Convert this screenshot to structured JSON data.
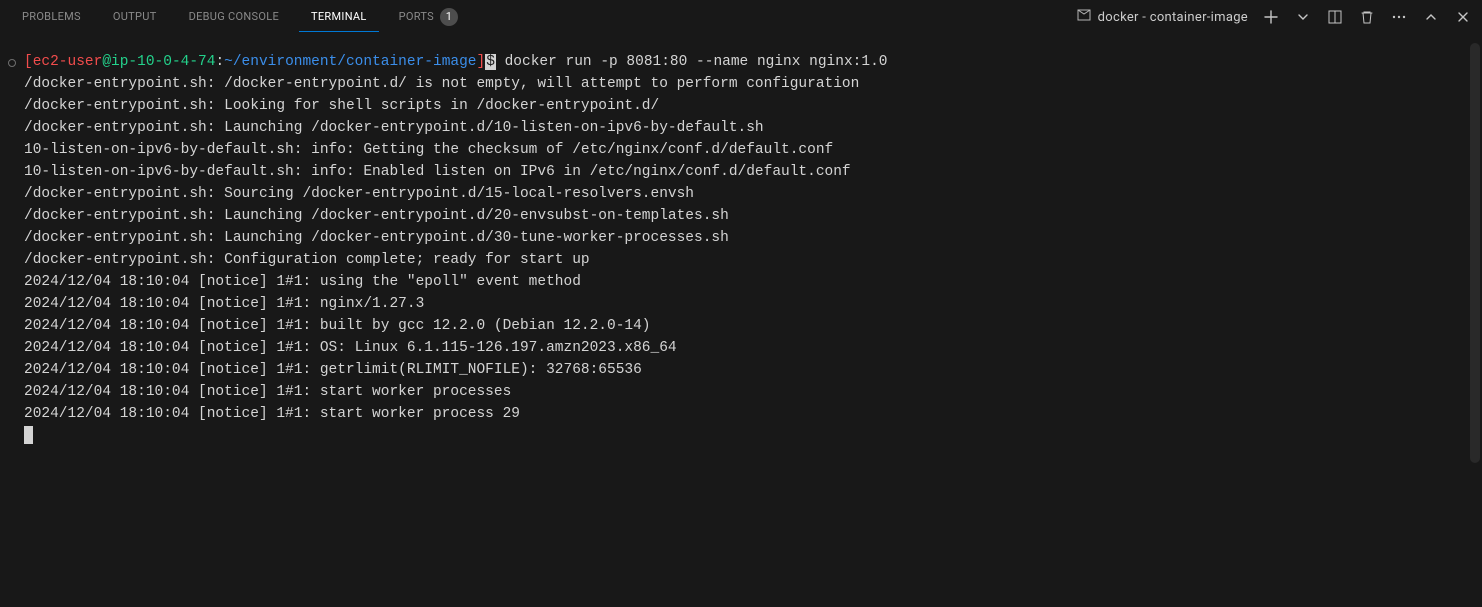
{
  "tabs": {
    "problems": "PROBLEMS",
    "output": "OUTPUT",
    "debug": "DEBUG CONSOLE",
    "terminal": "TERMINAL",
    "ports": "PORTS",
    "ports_badge": "1"
  },
  "session": {
    "label": "docker - container-image"
  },
  "prompt": {
    "lb": "[",
    "user": "ec2-user",
    "at": "@",
    "host": "ip-10-0-4-74",
    "colon": ":",
    "path": "~/environment/container-image",
    "rb": "]",
    "dollar": "$",
    "command": " docker run -p 8081:80 --name nginx nginx:1.0"
  },
  "output_lines": [
    "/docker-entrypoint.sh: /docker-entrypoint.d/ is not empty, will attempt to perform configuration",
    "/docker-entrypoint.sh: Looking for shell scripts in /docker-entrypoint.d/",
    "/docker-entrypoint.sh: Launching /docker-entrypoint.d/10-listen-on-ipv6-by-default.sh",
    "10-listen-on-ipv6-by-default.sh: info: Getting the checksum of /etc/nginx/conf.d/default.conf",
    "10-listen-on-ipv6-by-default.sh: info: Enabled listen on IPv6 in /etc/nginx/conf.d/default.conf",
    "/docker-entrypoint.sh: Sourcing /docker-entrypoint.d/15-local-resolvers.envsh",
    "/docker-entrypoint.sh: Launching /docker-entrypoint.d/20-envsubst-on-templates.sh",
    "/docker-entrypoint.sh: Launching /docker-entrypoint.d/30-tune-worker-processes.sh",
    "/docker-entrypoint.sh: Configuration complete; ready for start up",
    "2024/12/04 18:10:04 [notice] 1#1: using the \"epoll\" event method",
    "2024/12/04 18:10:04 [notice] 1#1: nginx/1.27.3",
    "2024/12/04 18:10:04 [notice] 1#1: built by gcc 12.2.0 (Debian 12.2.0-14)",
    "2024/12/04 18:10:04 [notice] 1#1: OS: Linux 6.1.115-126.197.amzn2023.x86_64",
    "2024/12/04 18:10:04 [notice] 1#1: getrlimit(RLIMIT_NOFILE): 32768:65536",
    "2024/12/04 18:10:04 [notice] 1#1: start worker processes",
    "2024/12/04 18:10:04 [notice] 1#1: start worker process 29"
  ],
  "colors": {
    "bg": "#181818",
    "fg": "#d4d4d4",
    "red": "#f14c4c",
    "green": "#23d18b",
    "blue": "#3b8eea",
    "accent": "#0078d4"
  }
}
